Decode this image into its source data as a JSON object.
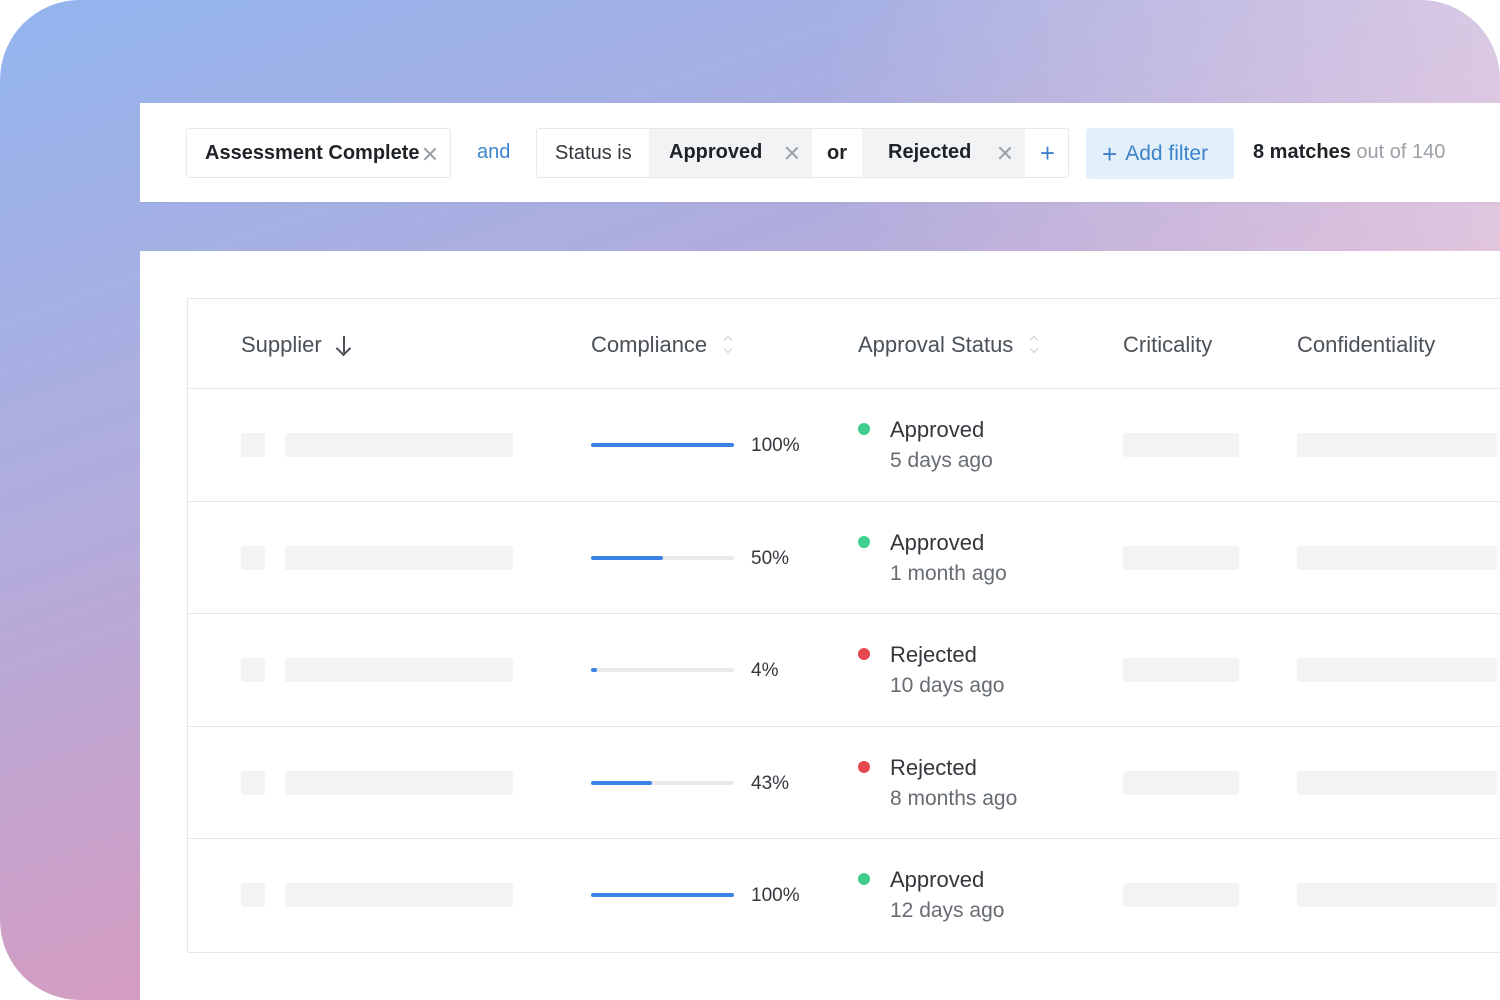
{
  "filters": {
    "chip1": {
      "label": "Assessment Complete"
    },
    "and_label": "and",
    "chip2": {
      "prefix": "Status is",
      "value1": "Approved",
      "joiner": "or",
      "value2": "Rejected",
      "plus": "+"
    },
    "add_filter": {
      "icon": "+",
      "label": "Add filter"
    },
    "matches": {
      "count": "8 matches",
      "rest": " out of 140"
    }
  },
  "table": {
    "columns": [
      "Supplier",
      "Compliance",
      "Approval Status",
      "Criticality",
      "Confidentiality"
    ],
    "rows": [
      {
        "compliance": 100,
        "compliance_label": "100%",
        "status": "Approved",
        "status_color": "#3ecf8e",
        "time": "5 days ago"
      },
      {
        "compliance": 50,
        "compliance_label": "50%",
        "status": "Approved",
        "status_color": "#3ecf8e",
        "time": "1 month ago"
      },
      {
        "compliance": 4,
        "compliance_label": "4%",
        "status": "Rejected",
        "status_color": "#e5484d",
        "time": "10 days ago"
      },
      {
        "compliance": 43,
        "compliance_label": "43%",
        "status": "Rejected",
        "status_color": "#e5484d",
        "time": "8 months ago"
      },
      {
        "compliance": 100,
        "compliance_label": "100%",
        "status": "Approved",
        "status_color": "#3ecf8e",
        "time": "12 days ago"
      }
    ]
  },
  "colors": {
    "accent": "#3d83c9",
    "bar": "#3b82e6",
    "approved": "#3ecf8e",
    "rejected": "#e5484d"
  }
}
